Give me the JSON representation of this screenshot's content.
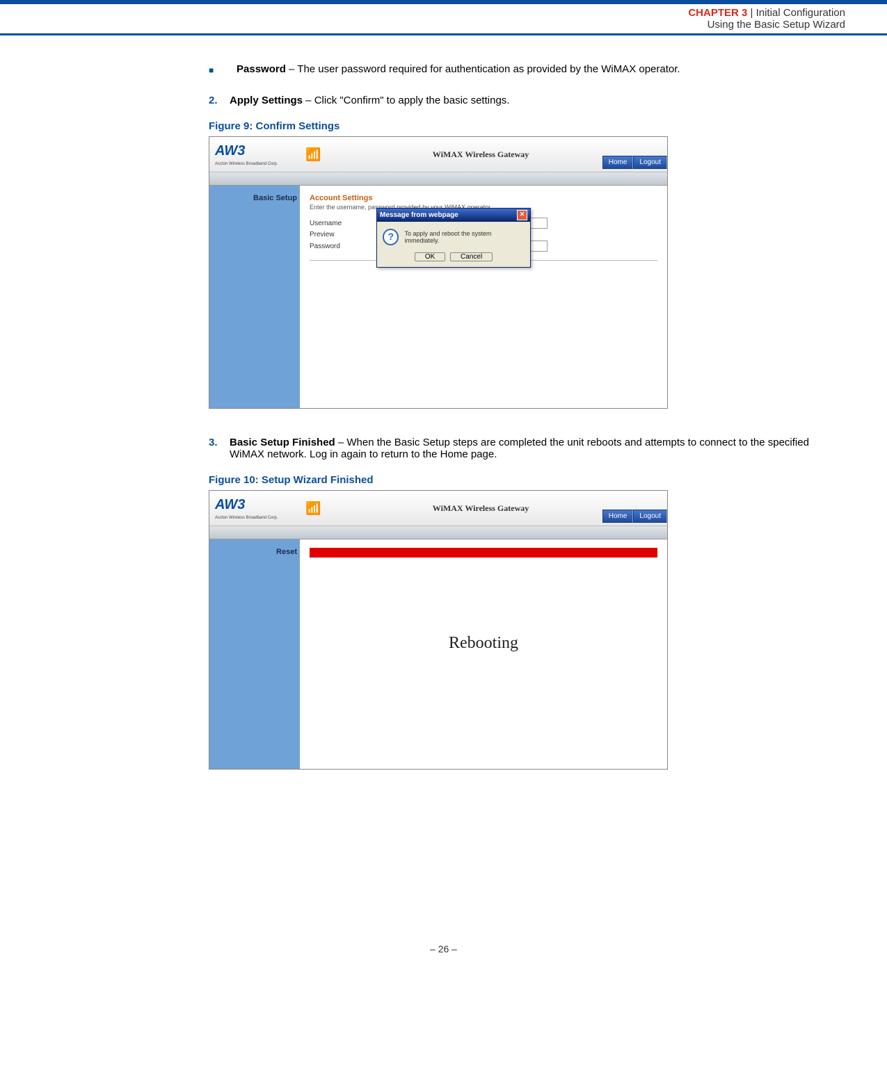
{
  "header": {
    "chapter": "CHAPTER 3",
    "sep": "  |  ",
    "title": "Initial Configuration",
    "sub": "Using the Basic Setup Wizard"
  },
  "bullet1": {
    "label": "Password",
    "text": " – The user password required for authentication as provided by the WiMAX operator."
  },
  "step2": {
    "num": "2.",
    "label": "Apply Settings",
    "text": " – Click \"Confirm\" to apply the basic settings."
  },
  "fig9": {
    "caption": "Figure 9:  Confirm Settings",
    "gateway": "WiMAX Wireless Gateway",
    "logo": "AW3",
    "logo_sub": "Accton Wireless Broadband Corp.",
    "nav_home": "Home",
    "nav_logout": "Logout",
    "side": "Basic Setup",
    "section": "Account Settings",
    "desc": "Enter the username, password provided by your WiMAX operator.",
    "f_user": "Username",
    "f_preview": "Preview",
    "f_pass": "Password",
    "dialog_title": "Message from webpage",
    "dialog_msg": "To apply and reboot the system immediately.",
    "dialog_ok": "OK",
    "dialog_cancel": "Cancel"
  },
  "step3": {
    "num": "3.",
    "label": "Basic Setup Finished",
    "text": " – When the Basic Setup steps are completed the unit reboots and attempts to connect to the specified WiMAX network. Log in again to return to the Home page."
  },
  "fig10": {
    "caption": "Figure 10:  Setup Wizard Finished",
    "gateway": "WiMAX Wireless Gateway",
    "logo": "AW3",
    "logo_sub": "Accton Wireless Broadband Corp.",
    "nav_home": "Home",
    "nav_logout": "Logout",
    "side": "Reset",
    "reboot": "Rebooting"
  },
  "footer": "–  26  –"
}
